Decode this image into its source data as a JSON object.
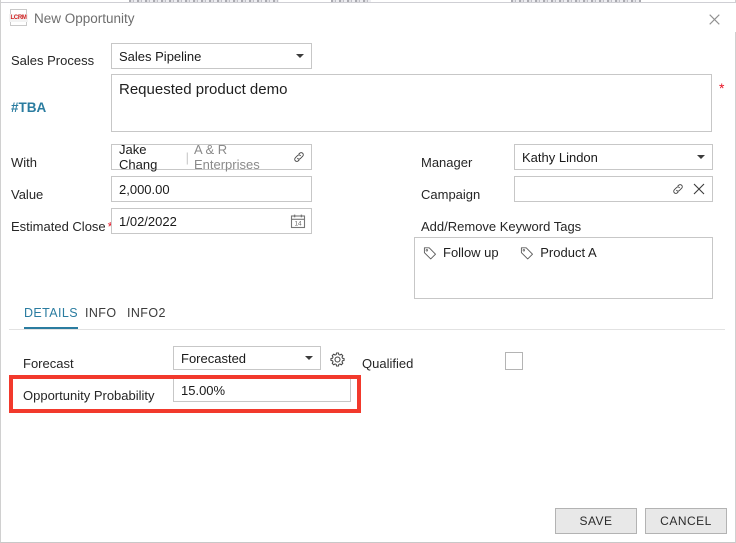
{
  "window": {
    "title": "New Opportunity",
    "app_icon": "lcrm-logo-icon",
    "app_icon_text": "LCRM",
    "close_icon": "close-icon"
  },
  "form": {
    "sales_process": {
      "label": "Sales Process",
      "value": "Sales Pipeline",
      "icon": "chevron-down-icon"
    },
    "note": {
      "label": "#TBA",
      "value": "Requested product demo",
      "required": "*"
    },
    "with": {
      "label": "With",
      "primary": "Jake Chang",
      "separator": "|",
      "secondary": "A & R Enterprises",
      "icon": "link-icon"
    },
    "value": {
      "label": "Value",
      "value": "2,000.00"
    },
    "estimated_close": {
      "label": "Estimated Close",
      "required": "*",
      "value": "1/02/2022",
      "icon": "calendar-icon",
      "icon_day": "14"
    },
    "manager": {
      "label": "Manager",
      "value": "Kathy Lindon",
      "icon": "chevron-down-icon"
    },
    "campaign": {
      "label": "Campaign",
      "value": "",
      "placeholder": "",
      "link_icon": "link-icon",
      "clear_icon": "clear-icon"
    },
    "keyword_tags": {
      "label": "Add/Remove Keyword Tags",
      "tags": [
        {
          "label": "Follow up",
          "icon": "tag-icon"
        },
        {
          "label": "Product A",
          "icon": "tag-icon"
        }
      ]
    }
  },
  "tabs": [
    {
      "label": "DETAILS",
      "active": true
    },
    {
      "label": "INFO",
      "active": false
    },
    {
      "label": "INFO2",
      "active": false
    }
  ],
  "details": {
    "forecast": {
      "label": "Forecast",
      "value": "Forecasted",
      "icon": "chevron-down-icon",
      "settings_icon": "gear-icon"
    },
    "qualified": {
      "label": "Qualified",
      "checked": false
    },
    "opportunity_probability": {
      "label": "Opportunity Probability",
      "value": "15.00%"
    }
  },
  "footer": {
    "save_label": "SAVE",
    "cancel_label": "CANCEL"
  },
  "colors": {
    "accent": "#2a7ca0",
    "required": "#e81123",
    "annotation": "#f2392c",
    "logo": "#d02020"
  }
}
